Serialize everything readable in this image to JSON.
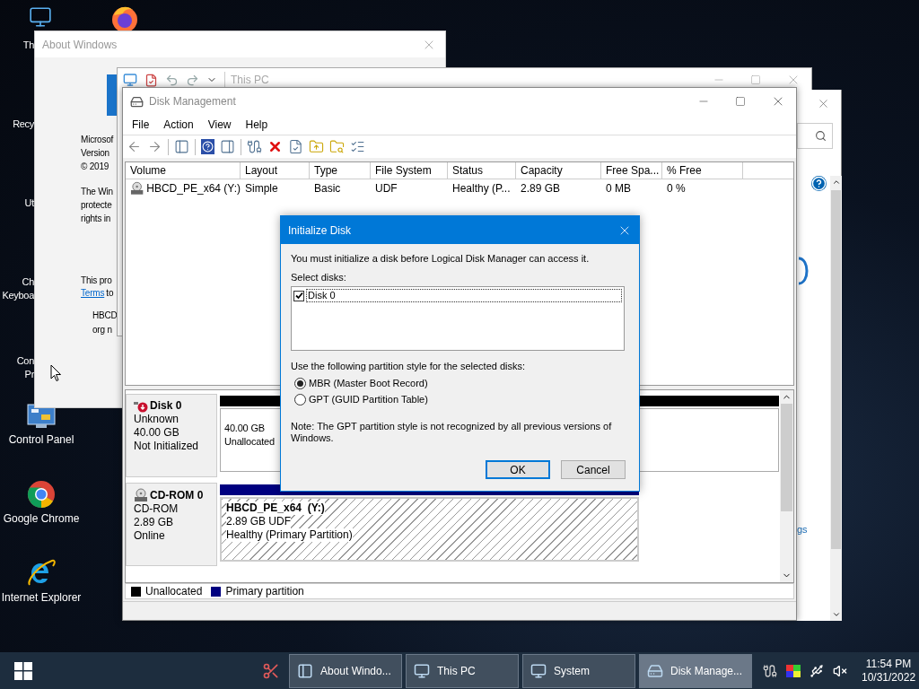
{
  "desktop_icons": [
    {
      "lines": [
        "Th"
      ]
    },
    {
      "lines": [
        "Recy"
      ]
    },
    {
      "lines": [
        "Ut"
      ]
    },
    {
      "lines": [
        "Ch",
        "Keyboa"
      ]
    },
    {
      "lines": [
        "Con",
        "Pr"
      ]
    },
    {
      "lines": [
        "Control Panel"
      ]
    },
    {
      "lines": [
        "Google Chrome"
      ]
    },
    {
      "lines": [
        "Internet Explorer"
      ]
    }
  ],
  "about_window": {
    "title": "About Windows",
    "blocks": [
      {
        "kind": "group",
        "lines": [
          "Microsof",
          "Version",
          "© 2019"
        ]
      },
      {
        "kind": "group",
        "lines": [
          "The Win",
          "protecte",
          "rights in"
        ]
      },
      {
        "kind": "license",
        "text": "This pro",
        "link": "Terms",
        "after": "to"
      },
      {
        "kind": "indent",
        "lines": [
          "HBCD",
          "org n"
        ]
      }
    ]
  },
  "this_pc_window": {
    "title": "This PC"
  },
  "system_window": {
    "link": "gs"
  },
  "disk_management": {
    "title": "Disk Management",
    "menu": [
      "File",
      "Action",
      "View",
      "Help"
    ],
    "columns": [
      "Volume",
      "Layout",
      "Type",
      "File System",
      "Status",
      "Capacity",
      "Free Spa...",
      "% Free"
    ],
    "rows": [
      {
        "cells": [
          "HBCD_PE_x64 (Y:)",
          "Simple",
          "Basic",
          "UDF",
          "Healthy (P...",
          "2.89 GB",
          "0 MB",
          "0 %"
        ]
      }
    ],
    "disks": [
      {
        "kind": "disk",
        "name": "Disk 0",
        "lines": [
          "Unknown",
          "40.00 GB",
          "Not Initialized"
        ],
        "partitions": [
          {
            "kind": "unallocated",
            "lines": [
              "40.00 GB",
              "Unallocated"
            ]
          }
        ]
      },
      {
        "kind": "cdrom",
        "name": "CD-ROM 0",
        "lines": [
          "CD-ROM",
          "2.89 GB",
          "Online"
        ],
        "partitions": [
          {
            "kind": "primary",
            "title": "HBCD_PE_x64  (Y:)",
            "lines": [
              "2.89 GB UDF",
              "Healthy (Primary Partition)"
            ]
          }
        ]
      }
    ],
    "legend": [
      {
        "label": "Unallocated",
        "color": "#000000"
      },
      {
        "label": "Primary partition",
        "color": "#000080"
      }
    ]
  },
  "dialog": {
    "title": "Initialize Disk",
    "message": "You must initialize a disk before Logical Disk Manager can access it.",
    "select_label": "Select disks:",
    "disks": [
      {
        "label": "Disk 0",
        "checked": true
      }
    ],
    "style_label": "Use the following partition style for the selected disks:",
    "styles": [
      {
        "label": "MBR (Master Boot Record)",
        "selected": true
      },
      {
        "label": "GPT (GUID Partition Table)",
        "selected": false
      }
    ],
    "note": "Note: The GPT partition style is not recognized by all previous versions of Windows.",
    "buttons": [
      {
        "label": "OK",
        "default": true
      },
      {
        "label": "Cancel",
        "default": false
      }
    ]
  },
  "taskbar": {
    "items": [
      {
        "label": "About Windo...",
        "selected": false
      },
      {
        "label": "This PC",
        "selected": false
      },
      {
        "label": "System",
        "selected": false
      },
      {
        "label": "Disk Manage...",
        "selected": true
      }
    ],
    "time": "11:54 PM",
    "date": "10/31/2022"
  }
}
